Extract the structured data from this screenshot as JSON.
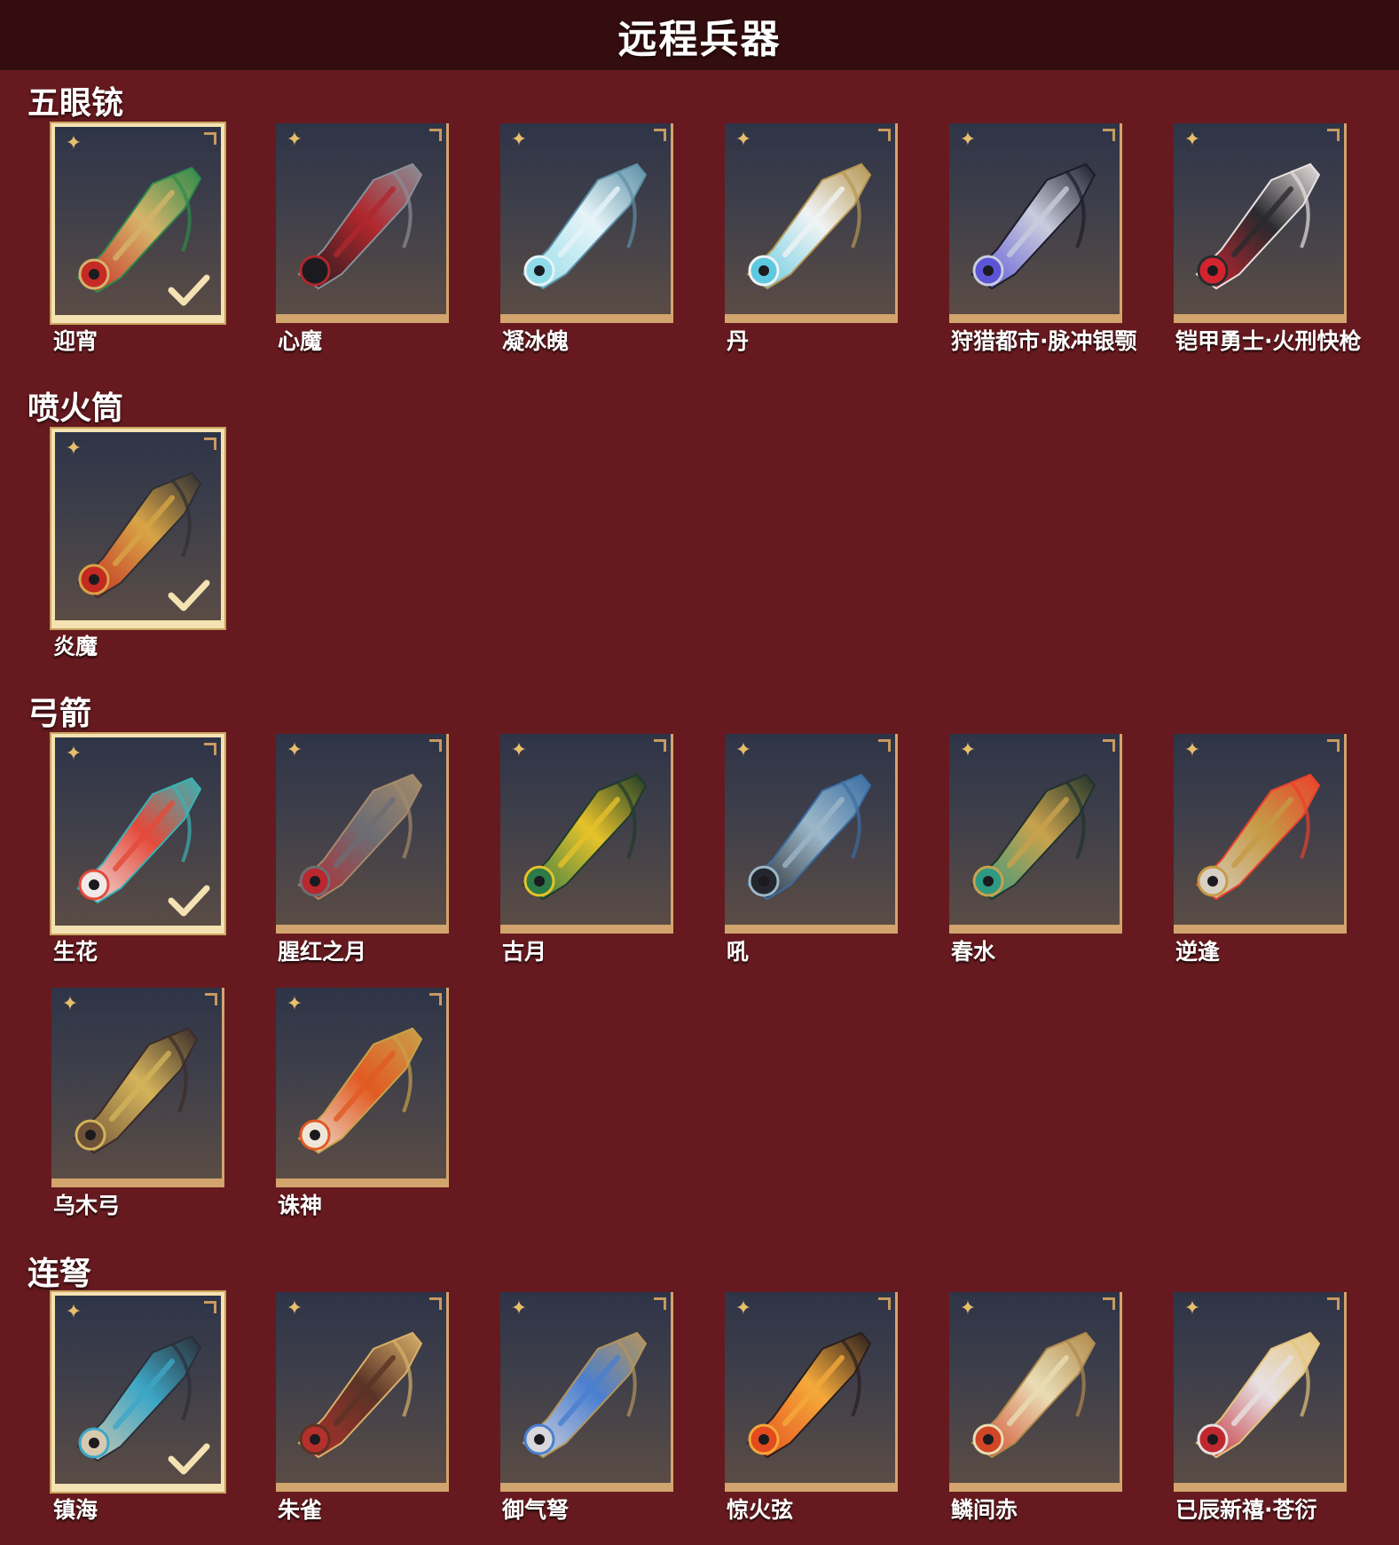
{
  "page_title": "远程兵器",
  "categories": [
    {
      "title": "五眼铳",
      "items": [
        {
          "name": "迎宵",
          "selected": true,
          "colors": [
            "#c62a25",
            "#d6b46a",
            "#2e8a4b"
          ]
        },
        {
          "name": "心魔",
          "selected": false,
          "colors": [
            "#1b1b1f",
            "#b0272d",
            "#8a8f98"
          ]
        },
        {
          "name": "凝冰魄",
          "selected": false,
          "colors": [
            "#8fdbe9",
            "#e6f4f8",
            "#5c8fa6"
          ]
        },
        {
          "name": "丹",
          "selected": false,
          "colors": [
            "#5ec8e0",
            "#f0f3f4",
            "#b69753"
          ]
        },
        {
          "name": "狩猎都市·脉冲银颚",
          "selected": false,
          "colors": [
            "#5b55d6",
            "#c9ccdd",
            "#1d1b2a"
          ]
        },
        {
          "name": "铠甲勇士·火刑快枪",
          "selected": false,
          "colors": [
            "#d3242e",
            "#2a2a2e",
            "#e8e0e0"
          ]
        }
      ]
    },
    {
      "title": "喷火筒",
      "items": [
        {
          "name": "炎魔",
          "selected": true,
          "colors": [
            "#c22a22",
            "#d8a446",
            "#2f2f34"
          ]
        }
      ]
    },
    {
      "title": "弓箭",
      "items": [
        {
          "name": "生花",
          "selected": true,
          "colors": [
            "#f1e8e8",
            "#e44a3a",
            "#38b3b5"
          ]
        },
        {
          "name": "腥红之月",
          "selected": false,
          "colors": [
            "#b9282f",
            "#6d6d74",
            "#a48a6a"
          ]
        },
        {
          "name": "古月",
          "selected": false,
          "colors": [
            "#2c7a48",
            "#e6c22a",
            "#1e3c2a"
          ]
        },
        {
          "name": "吼",
          "selected": false,
          "colors": [
            "#23262d",
            "#9cb7c8",
            "#3a6ea3"
          ]
        },
        {
          "name": "春水",
          "selected": false,
          "colors": [
            "#2f9a82",
            "#c9a24d",
            "#20332c"
          ]
        },
        {
          "name": "逆逢",
          "selected": false,
          "colors": [
            "#d9d0c4",
            "#c69a45",
            "#e9422c"
          ]
        },
        {
          "name": "乌木弓",
          "selected": false,
          "colors": [
            "#6d5238",
            "#d4b35a",
            "#3a2c2a"
          ]
        },
        {
          "name": "诛神",
          "selected": false,
          "colors": [
            "#f0e6d8",
            "#e15a22",
            "#c9a04a"
          ]
        }
      ]
    },
    {
      "title": "连弩",
      "items": [
        {
          "name": "镇海",
          "selected": true,
          "colors": [
            "#d7c8b0",
            "#3da7c6",
            "#2b2f38"
          ]
        },
        {
          "name": "朱雀",
          "selected": false,
          "colors": [
            "#b5302c",
            "#5b3326",
            "#d8b06a"
          ]
        },
        {
          "name": "御气弩",
          "selected": false,
          "colors": [
            "#d8d8dc",
            "#4b7fd0",
            "#b3945c"
          ]
        },
        {
          "name": "惊火弦",
          "selected": false,
          "colors": [
            "#e44a1e",
            "#f4a93a",
            "#2a1e1e"
          ]
        },
        {
          "name": "鳞间赤",
          "selected": false,
          "colors": [
            "#d24628",
            "#e9ddb5",
            "#b18a4c"
          ]
        },
        {
          "name": "已辰新禧·苍衍",
          "selected": false,
          "colors": [
            "#c0282f",
            "#e7e0e2",
            "#e5c47a"
          ]
        }
      ]
    }
  ]
}
